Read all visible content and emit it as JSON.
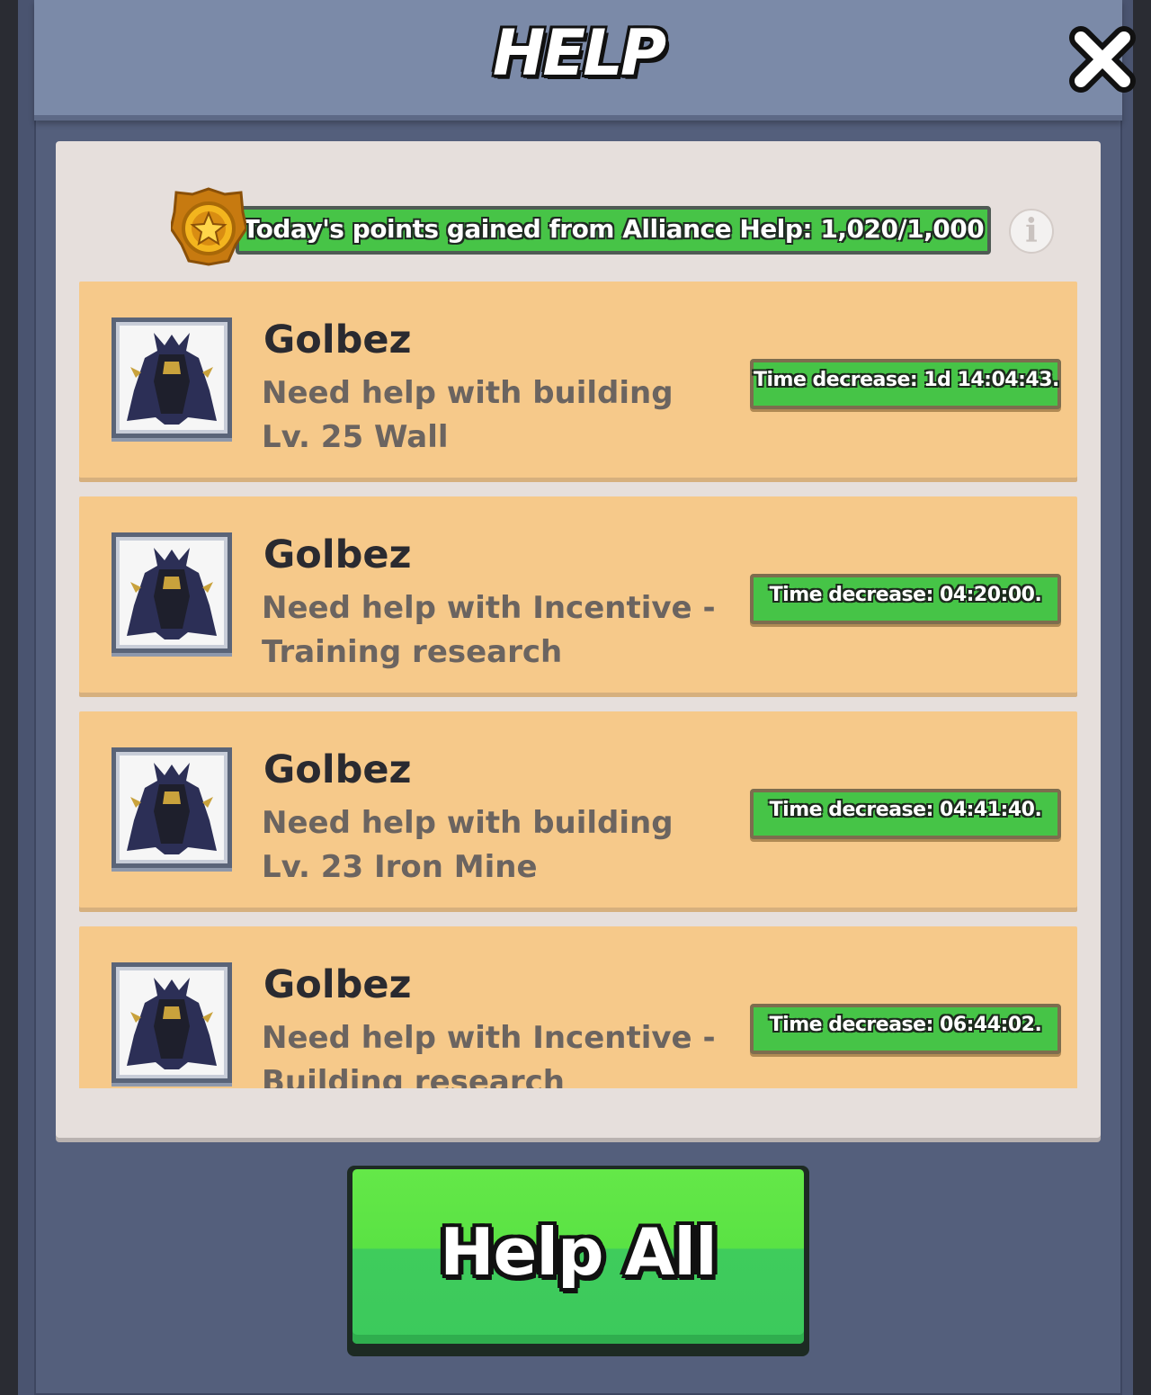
{
  "header": {
    "title": "HELP",
    "close_icon": "close-icon"
  },
  "points": {
    "badge_icon": "star-medal-icon",
    "text": "Today's points gained from Alliance Help: 1,020/1,000",
    "info_icon": "info-icon",
    "info_glyph": "i"
  },
  "requests": [
    {
      "name": "Golbez",
      "description": "Need help with building Lv. 25 Wall",
      "time": "Time decrease: 1d 14:04:43."
    },
    {
      "name": "Golbez",
      "description": "Need help with Incentive - Training research",
      "time": "Time decrease: 04:20:00."
    },
    {
      "name": "Golbez",
      "description": "Need help with building Lv. 23 Iron Mine",
      "time": "Time decrease: 04:41:40."
    },
    {
      "name": "Golbez",
      "description": "Need help with Incentive - Building research",
      "time": "Time decrease: 06:44:02."
    }
  ],
  "footer": {
    "help_all_label": "Help All"
  },
  "colors": {
    "card": "#f6c98a",
    "green": "#46c447",
    "header": "#7b8aa8",
    "panel": "#545f7c"
  }
}
